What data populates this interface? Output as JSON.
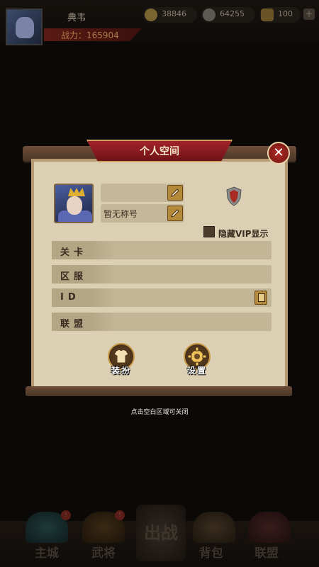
{
  "top": {
    "player_name": "典韦",
    "power": "战力：165904",
    "resources": [
      {
        "icon": "gold-coin-icon",
        "value": "38846"
      },
      {
        "icon": "silver-coin-icon",
        "value": "64255"
      },
      {
        "icon": "ingot-icon",
        "value": "100"
      }
    ],
    "add_symbol": "+"
  },
  "dialog": {
    "title": "个人空间",
    "close_symbol": "✕",
    "name_value": "",
    "title_value": "暂无称号",
    "hide_vip": "隐藏VIP显示",
    "rows": [
      {
        "label": "关卡",
        "value": ""
      },
      {
        "label": "区服",
        "value": ""
      },
      {
        "label": "ID",
        "value": ""
      },
      {
        "label": "联盟",
        "value": ""
      }
    ],
    "actions": [
      {
        "label": "装扮",
        "icon": "shirt-icon"
      },
      {
        "label": "设置",
        "icon": "gear-icon"
      }
    ]
  },
  "hint": "点击空白区域可关闭",
  "nav": {
    "items": [
      {
        "label": "主城",
        "icon": "city-icon",
        "badge": "!"
      },
      {
        "label": "武将",
        "icon": "general-icon",
        "badge": "!"
      },
      {
        "label": "出战",
        "icon": "battle-icon",
        "badge": ""
      },
      {
        "label": "背包",
        "icon": "bag-icon",
        "badge": ""
      },
      {
        "label": "联盟",
        "icon": "alliance-icon",
        "badge": ""
      }
    ]
  },
  "colors": {
    "panel": "#dcd0b4",
    "ribbon": "#a4232b",
    "frame": "#4a3426",
    "accent_gold": "#c89a45"
  }
}
